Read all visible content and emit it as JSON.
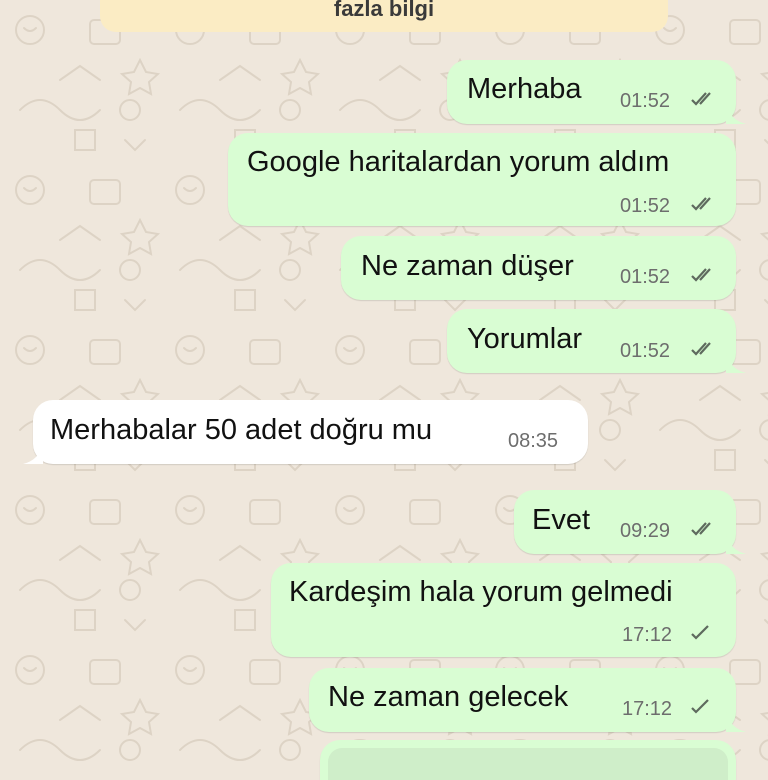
{
  "colors": {
    "outgoing_bubble": "#d9fdd3",
    "incoming_bubble": "#ffffff",
    "notice_bg": "#fbecc4",
    "wallpaper": "#efe7dc",
    "tick_color": "#5e6a5e"
  },
  "notice": {
    "text": "fazla bilgi"
  },
  "messages": [
    {
      "text": "Merhaba",
      "time": "01:52",
      "direction": "outgoing",
      "status": "read-double-tick-icon"
    },
    {
      "text": "Google haritalardan yorum aldım",
      "time": "01:52",
      "direction": "outgoing",
      "status": "read-double-tick-icon"
    },
    {
      "text": "Ne zaman düşer",
      "time": "01:52",
      "direction": "outgoing",
      "status": "read-double-tick-icon"
    },
    {
      "text": "Yorumlar",
      "time": "01:52",
      "direction": "outgoing",
      "status": "read-double-tick-icon"
    },
    {
      "text": "Merhabalar 50 adet doğru mu",
      "time": "08:35",
      "direction": "incoming"
    },
    {
      "text": "Evet",
      "time": "09:29",
      "direction": "outgoing",
      "status": "read-double-tick-icon"
    },
    {
      "text": "Kardeşim hala yorum gelmedi",
      "time": "17:12",
      "direction": "outgoing",
      "status": "sent-single-tick-icon"
    },
    {
      "text": "Ne zaman gelecek",
      "time": "17:12",
      "direction": "outgoing",
      "status": "sent-single-tick-icon"
    }
  ]
}
